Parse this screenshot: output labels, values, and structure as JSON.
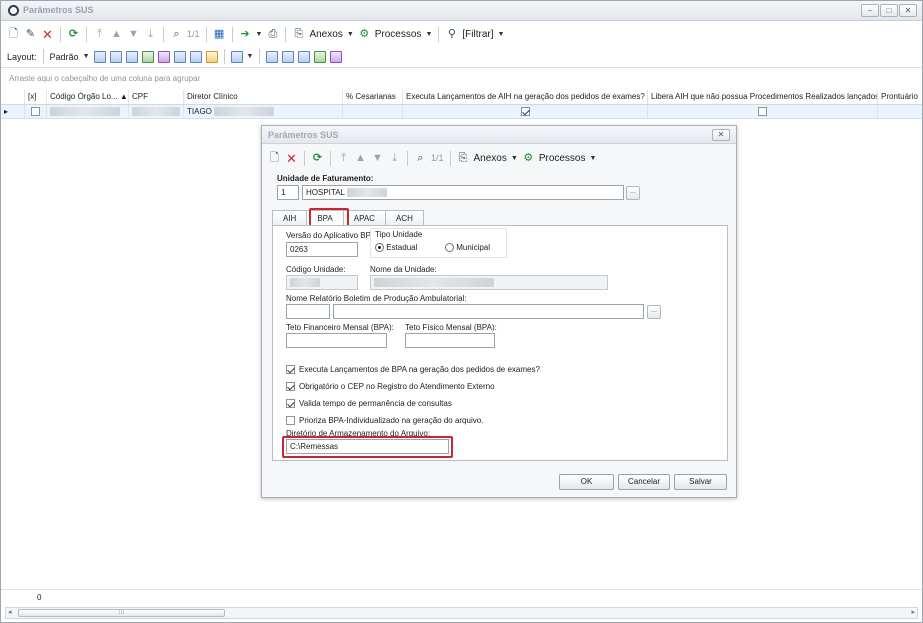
{
  "window": {
    "title": "Parâmetros SUS",
    "controls": [
      "‒",
      "□",
      "✕"
    ]
  },
  "toolbar": {
    "page_indicator": "1/1",
    "anexos": "Anexos",
    "processos": "Processos",
    "filtrar": "[Filtrar]"
  },
  "layout_bar": {
    "layout_label": "Layout:",
    "preset": "Padrão"
  },
  "grid": {
    "group_hint": "Arraste aqui o cabeçalho de uma coluna para agrupar",
    "columns": [
      "[x]",
      "Código Órgão Lo...",
      "CPF",
      "Diretor Clínico",
      "% Cesarianas",
      "Executa Lançamentos de AIH na geração dos pedidos de exames?",
      "Libera AIH que não possua Procedimentos Realizados lançados",
      "Prontuário"
    ],
    "sort_arrow": "▲",
    "row": {
      "indicator": "▸",
      "diretor": "TIAGO"
    },
    "row_count": "0"
  },
  "dialog": {
    "title": "Parâmetros SUS",
    "close": "✕",
    "page_indicator": "1/1",
    "anexos": "Anexos",
    "processos": "Processos",
    "unidade_label": "Unidade de Faturamento:",
    "unidade_code": "1",
    "unidade_name": "HOSPITAL",
    "tabs": [
      "AIH",
      "BPA",
      "APAC",
      "ACH"
    ],
    "active_tab": "BPA",
    "versao_label": "Versão do Aplicativo BPA:",
    "versao_value": "0263",
    "tipo_unidade_label": "Tipo Unidade",
    "tipo_estadual": "Estadual",
    "tipo_municipal": "Municipal",
    "codigo_unidade_label": "Código Unidade:",
    "nome_unidade_label": "Nome da Unidade:",
    "nome_relatorio_label": "Nome Relatório Boletim de Produção Ambulatorial:",
    "teto_financeiro_label": "Teto Financeiro Mensal (BPA):",
    "teto_fisico_label": "Teto Físico Mensal (BPA):",
    "checkboxes": [
      {
        "label": "Executa Lançamentos de BPA na geração dos pedidos de exames?",
        "checked": true
      },
      {
        "label": "Obrigatório o CEP no Registro do Atendimento Externo",
        "checked": true
      },
      {
        "label": "Valida tempo de permanência de consultas",
        "checked": true
      },
      {
        "label": "Prioriza BPA-Individualizado na geração do arquivo.",
        "checked": false
      }
    ],
    "diretorio_label": "Diretório de Armazenamento do Arquivo:",
    "diretorio_value": "C:\\Remessas",
    "ellipsis": "...",
    "ok": "OK",
    "cancelar": "Cancelar",
    "salvar": "Salvar"
  },
  "colors": {
    "highlight": "#c8272e",
    "selected_row": "#eaf3ff"
  }
}
